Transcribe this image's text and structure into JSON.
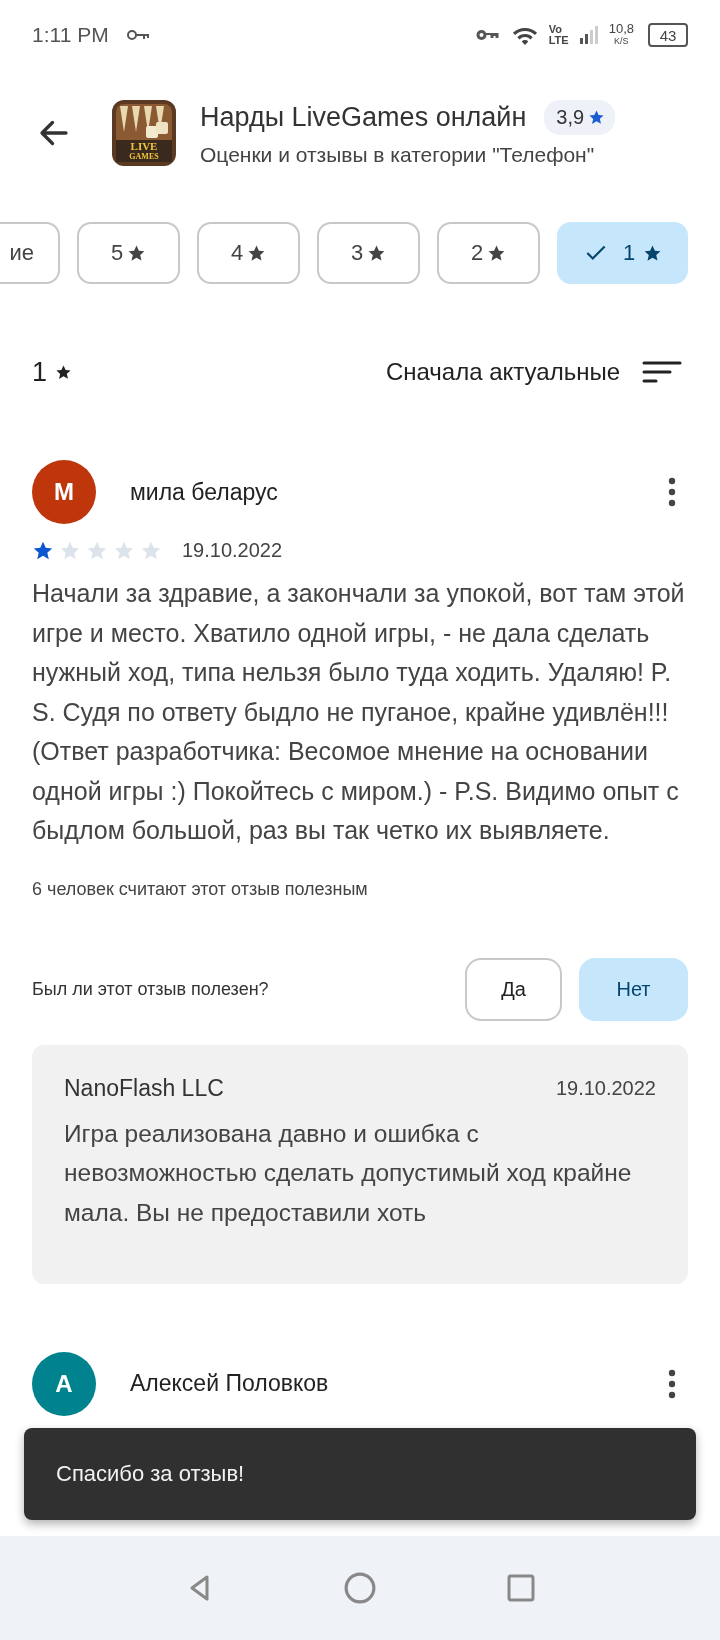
{
  "status_bar": {
    "time": "1:11 PM",
    "network_top": "Vo",
    "network_bottom": "LTE",
    "speed_value": "10,8",
    "speed_unit": "K/S",
    "battery": "43"
  },
  "header": {
    "title": "Нарды LiveGames онлайн",
    "rating": "3,9",
    "subtitle": "Оценки и отзывы в категории \"Телефон\"",
    "icon_text": [
      "LIVE",
      "GAMES"
    ]
  },
  "filter_chips": [
    {
      "label": "ие",
      "kind": "text",
      "selected": false
    },
    {
      "label": "5",
      "kind": "stars",
      "selected": false
    },
    {
      "label": "4",
      "kind": "stars",
      "selected": false
    },
    {
      "label": "3",
      "kind": "stars",
      "selected": false
    },
    {
      "label": "2",
      "kind": "stars",
      "selected": false
    },
    {
      "label": "1",
      "kind": "stars",
      "selected": true
    }
  ],
  "list_header": {
    "rating_filter": "1",
    "sort_label": "Сначала актуальные"
  },
  "reviews": [
    {
      "author": "мила беларус",
      "avatar_letter": "М",
      "color": "#bf360c",
      "stars": 1,
      "date": "19.10.2022",
      "text": "Начали за здравие, а закончали за упокой, вот там этой игре и место. Хватило одной игры, - не дала сделать нужный ход, типа нельзя было туда ходить. Удаляю! P. S. Судя по ответу быдло не пуганое, крайне удивлён!!! (Ответ разработчика: Весомое мнение на основании одной игры :) Покойтесь с миром.) - P.S. Видимо опыт с быдлом большой, раз вы так четко их выявляете.",
      "helpful_count": "6 человек считают этот отзыв полезным",
      "helpful_question": "Был ли этот отзыв полезен?",
      "vote_buttons": [
        {
          "label": "Да",
          "selected": false
        },
        {
          "label": "Нет",
          "selected": true
        }
      ],
      "reply": {
        "author": "NanoFlash LLC",
        "date": "19.10.2022",
        "text": "Игра реализована давно и ошибка с невозможностью сделать допустимый ход крайне мала. Вы не предоставили хоть"
      }
    },
    {
      "author": "Алексей Половков",
      "avatar_letter": "А",
      "color": "#00838f"
    }
  ],
  "snackbar": {
    "message": "Спасибо за отзыв!"
  }
}
